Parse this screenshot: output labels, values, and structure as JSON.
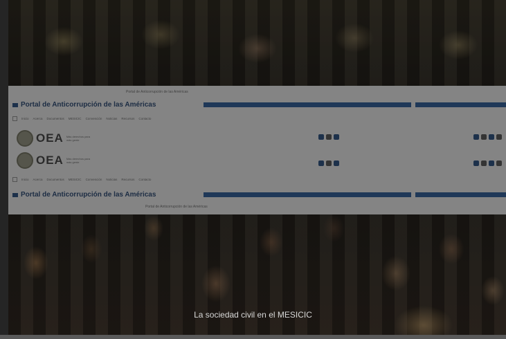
{
  "panel": {
    "top_caption": "Portal de Anticorrupción de las Américas",
    "sections": [
      {
        "title": "Portal de Anticorrupción de las Américas",
        "nav_items": [
          "Inicio",
          "Acerca",
          "Documentos",
          "MESICIC",
          "Convención",
          "Noticias",
          "Recursos",
          "Contacto"
        ]
      },
      {
        "title": "Portal de Anticorrupción de las Américas",
        "nav_items": [
          "Inicio",
          "Acerca",
          "Documentos",
          "MESICIC",
          "Convención",
          "Noticias",
          "Recursos",
          "Contacto"
        ]
      }
    ],
    "logos": [
      {
        "text": "OEA",
        "sub": "Más derechos para más gente"
      },
      {
        "text": "OEA",
        "sub": "Más derechos para más gente"
      }
    ],
    "bottom_caption": "Portal de Anticorrupción de las Américas"
  },
  "caption": "La sociedad civil en el MESICIC"
}
